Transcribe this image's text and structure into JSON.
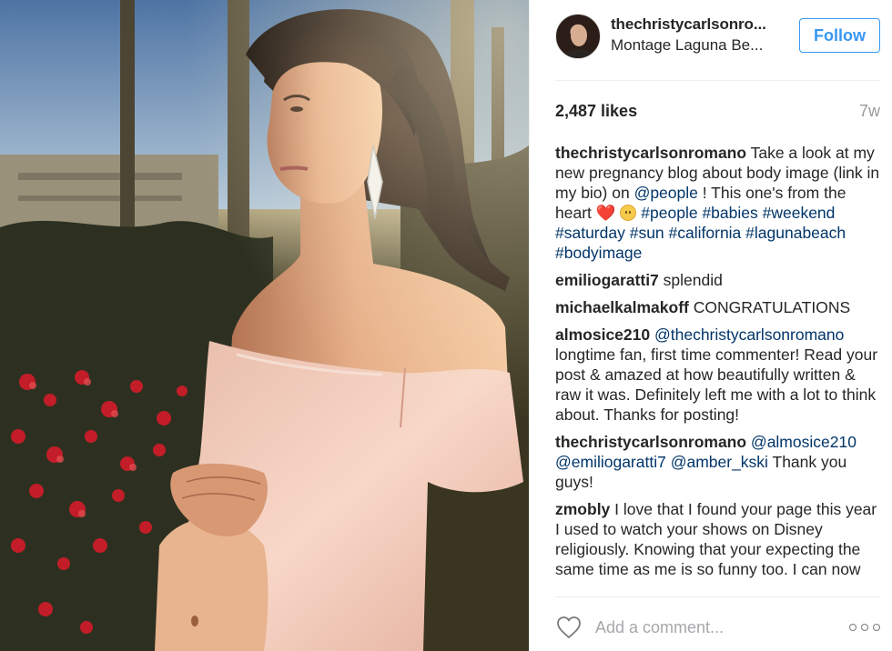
{
  "post": {
    "photo_alt": "",
    "header": {
      "username": "thechristycarlsonro...",
      "location": "Montage Laguna Be...",
      "follow_label": "Follow"
    },
    "likes": "2,487 likes",
    "time_ago": "7w",
    "caption": {
      "user": "thechristycarlsonromano",
      "text_1": " Take a look at my new pregnancy blog about body image (link in my bio) on ",
      "mention": "@people",
      "text_2": " ! This one's from the heart ",
      "heart": "❤️",
      "hashtags": "#people #babies #weekend #saturday #sun #california #lagunabeach #bodyimage"
    },
    "comments": [
      {
        "user": "emiliogaratti7",
        "text": " splendid"
      },
      {
        "user": "michaelkalmakoff",
        "text": " CONGRATULATIONS"
      },
      {
        "user": "almosice210",
        "mention": " @thechristycarlsonromano",
        "text": " longtime fan, first time commenter! Read your post & amazed at how beautifully written & raw it was. Definitely left me with a lot to think about. Thanks for posting!"
      },
      {
        "user": "thechristycarlsonromano",
        "mention": " @almosice210 @emiliogaratti7 @amber_kski",
        "text": " Thank you guys!"
      },
      {
        "user": "zmobly",
        "text": " I love that I found your page this year I used to watch your shows on Disney religiously. Knowing that your expecting the same time as me is so funny too. I can now"
      }
    ],
    "comment_placeholder": "Add a comment...",
    "colors": {
      "accent": "#3897f0",
      "link": "#003569",
      "muted": "#999999",
      "heart": "#d8203f"
    },
    "icons": {
      "like": "heart-outline-icon",
      "more": "more-options-icon"
    }
  }
}
